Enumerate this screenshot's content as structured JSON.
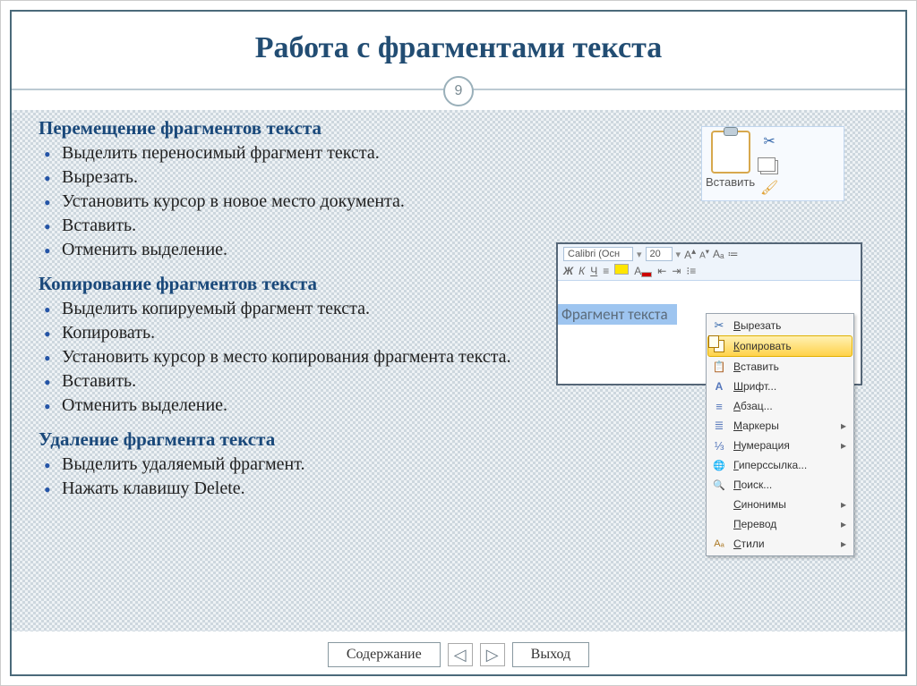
{
  "title": "Работа с фрагментами текста",
  "page_number": "9",
  "sections": [
    {
      "heading": "Перемещение фрагментов текста",
      "items": [
        "Выделить переносимый фрагмент текста.",
        "Вырезать.",
        "Установить курсор в новое место документа.",
        "Вставить.",
        "Отменить выделение."
      ]
    },
    {
      "heading": "Копирование фрагментов текста",
      "items": [
        "Выделить копируемый фрагмент текста.",
        "Копировать.",
        "Установить курсор в место копирования фрагмента текста.",
        "Вставить.",
        "Отменить выделение."
      ]
    },
    {
      "heading": "Удаление фрагмента текста",
      "items": [
        "Выделить удаляемый фрагмент.",
        "Нажать клавишу Delete."
      ]
    }
  ],
  "clipboard_ribbon": {
    "paste_label": "Вставить"
  },
  "word_snip": {
    "toolbar": {
      "font_name": "Calibri (Оcн",
      "font_size": "20",
      "grow": "A",
      "shrink": "A",
      "list_ic": "≔",
      "bold": "Ж",
      "italic": "К",
      "underline": "Ч",
      "center": "≡",
      "highlight": "A",
      "color": "A"
    },
    "fragment_text": "Фрагмент текста",
    "context_menu": [
      {
        "label": "Вырезать",
        "ul": "В",
        "icon": "cut",
        "hl": false
      },
      {
        "label": "Копировать",
        "ul": "К",
        "icon": "copy",
        "hl": true
      },
      {
        "label": "Вставить",
        "ul": "В",
        "icon": "paste",
        "hl": false
      },
      {
        "label": "Шрифт...",
        "ul": "Ш",
        "icon": "font",
        "hl": false
      },
      {
        "label": "Абзац...",
        "ul": "А",
        "icon": "para",
        "hl": false
      },
      {
        "label": "Маркеры",
        "ul": "М",
        "icon": "bullets",
        "hl": false,
        "sub": true
      },
      {
        "label": "Нумерация",
        "ul": "Н",
        "icon": "num",
        "hl": false,
        "sub": true
      },
      {
        "label": "Гиперссылка...",
        "ul": "Г",
        "icon": "link",
        "hl": false
      },
      {
        "label": "Поиск...",
        "ul": "П",
        "icon": "search",
        "hl": false
      },
      {
        "label": "Синонимы",
        "ul": "С",
        "icon": "",
        "hl": false,
        "sub": true
      },
      {
        "label": "Перевод",
        "ul": "П",
        "icon": "",
        "hl": false,
        "sub": true
      },
      {
        "label": "Стили",
        "ul": "С",
        "icon": "styles",
        "hl": false,
        "sub": true
      }
    ]
  },
  "footer": {
    "contents": "Содержание",
    "exit": "Выход"
  }
}
